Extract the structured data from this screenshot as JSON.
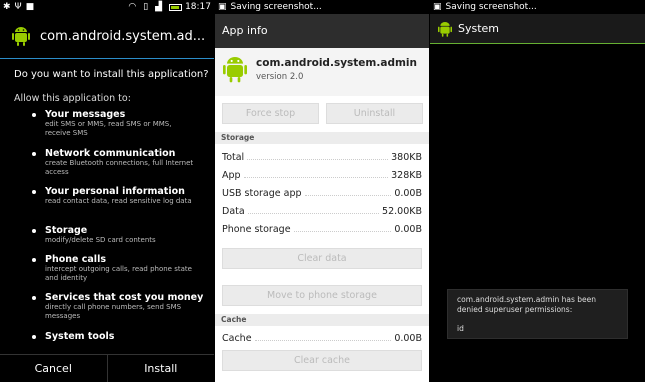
{
  "panel1": {
    "status": {
      "time": "18:17",
      "left_icons": [
        "usb-debug-icon",
        "usb-icon",
        "download-icon"
      ]
    },
    "header": {
      "title": "com.android.system.ad..."
    },
    "question": "Do you want to install this application?",
    "allow_label": "Allow this application to:",
    "permissions": [
      {
        "title": "Your messages",
        "desc": "edit SMS or MMS, read SMS or MMS, receive SMS"
      },
      {
        "title": "Network communication",
        "desc": "create Bluetooth connections, full Internet access"
      },
      {
        "title": "Your personal information",
        "desc": "read contact data, read sensitive log data"
      },
      {
        "title": "Storage",
        "desc": "modify/delete SD card contents"
      },
      {
        "title": "Phone calls",
        "desc": "intercept outgoing calls, read phone state and identity"
      },
      {
        "title": "Services that cost you money",
        "desc": "directly call phone numbers, send SMS messages"
      },
      {
        "title": "System tools",
        "desc": ""
      }
    ],
    "buttons": {
      "cancel": "Cancel",
      "install": "Install"
    }
  },
  "panel2": {
    "status": {
      "text": "Saving screenshot..."
    },
    "title": "App info",
    "app": {
      "name": "com.android.system.admin",
      "version": "version 2.0"
    },
    "buttons": {
      "force_stop": "Force stop",
      "uninstall": "Uninstall",
      "clear_data": "Clear data",
      "move": "Move to phone storage",
      "clear_cache": "Clear cache"
    },
    "storage_label": "Storage",
    "storage_rows": [
      {
        "label": "Total",
        "value": "380KB"
      },
      {
        "label": "App",
        "value": "328KB"
      },
      {
        "label": "USB storage app",
        "value": "0.00B"
      },
      {
        "label": "Data",
        "value": "52.00KB"
      },
      {
        "label": "Phone storage",
        "value": "0.00B"
      }
    ],
    "cache_label": "Cache",
    "cache_row": {
      "label": "Cache",
      "value": "0.00B"
    }
  },
  "panel3": {
    "status": {
      "text": "Saving screenshot..."
    },
    "title": "System",
    "toast": {
      "message": "com.android.system.admin has been denied superuser permissions:",
      "command": "id"
    }
  },
  "colors": {
    "android_green": "#9c0",
    "holo_blue": "#2b8dc9",
    "superuser_green": "#66b032"
  }
}
